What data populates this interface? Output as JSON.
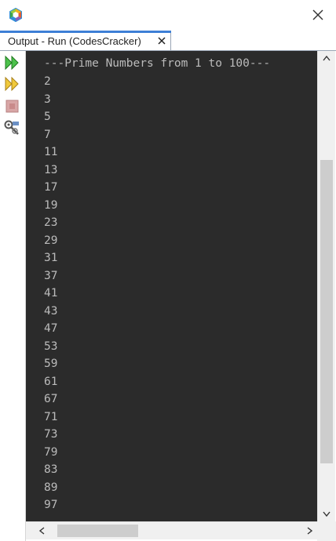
{
  "window": {
    "logo_icon": "netbeans-logo-icon",
    "close_icon": "close-icon"
  },
  "tab": {
    "label": "Output - Run (CodesCracker)",
    "close_icon": "tab-close-icon"
  },
  "toolbar": {
    "tools": [
      {
        "name": "rerun-icon",
        "color": "#2e9a2e"
      },
      {
        "name": "rerun-with-options-icon",
        "color": "#d6a51a"
      },
      {
        "name": "stop-icon",
        "color": "#c98a8a"
      },
      {
        "name": "settings-icon",
        "color": "#666666"
      }
    ]
  },
  "console": {
    "title": "---Prime Numbers from 1 to 100---",
    "lines": [
      "2",
      "3",
      "5",
      "7",
      "11",
      "13",
      "17",
      "19",
      "23",
      "29",
      "31",
      "37",
      "41",
      "43",
      "47",
      "53",
      "59",
      "61",
      "67",
      "71",
      "73",
      "79",
      "83",
      "89",
      "97"
    ],
    "background": "#2b2b2b",
    "text_color": "#bbbbbb"
  },
  "scrollbars": {
    "up_icon": "chevron-up-icon",
    "down_icon": "chevron-down-icon",
    "left_icon": "chevron-left-icon",
    "right_icon": "chevron-right-icon"
  }
}
